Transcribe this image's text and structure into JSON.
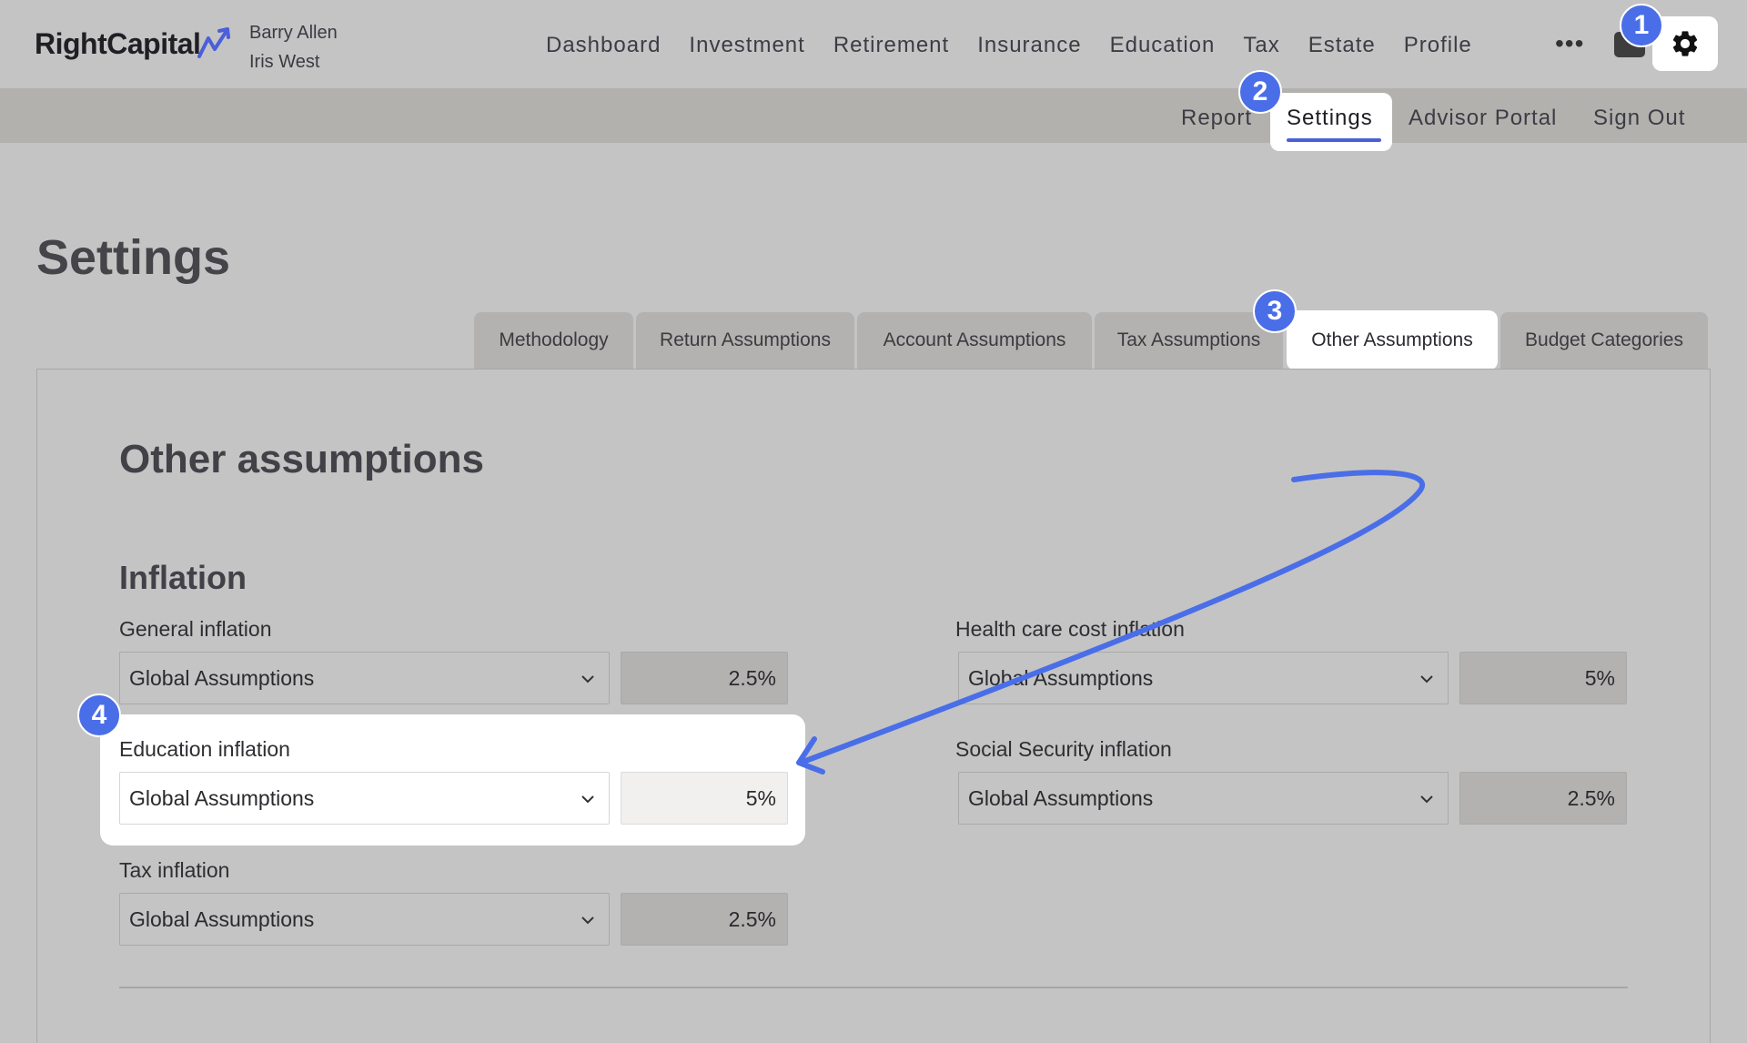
{
  "brand": {
    "name": "RightCapital"
  },
  "clients": [
    "Barry Allen",
    "Iris West"
  ],
  "main_nav": [
    "Dashboard",
    "Investment",
    "Retirement",
    "Insurance",
    "Education",
    "Tax",
    "Estate",
    "Profile"
  ],
  "more_label": "•••",
  "sub_nav": {
    "report": "Report",
    "settings": "Settings",
    "advisor_portal": "Advisor Portal",
    "sign_out": "Sign Out"
  },
  "page_title": "Settings",
  "tabs": [
    "Methodology",
    "Return Assumptions",
    "Account Assumptions",
    "Tax Assumptions",
    "Other Assumptions",
    "Budget Categories"
  ],
  "active_tab": "Other Assumptions",
  "section_title": "Other assumptions",
  "inflation": {
    "title": "Inflation",
    "general": {
      "label": "General inflation",
      "source": "Global Assumptions",
      "value": "2.5%"
    },
    "health": {
      "label": "Health care cost inflation",
      "source": "Global Assumptions",
      "value": "5%"
    },
    "education": {
      "label": "Education inflation",
      "source": "Global Assumptions",
      "value": "5%"
    },
    "social_security": {
      "label": "Social Security inflation",
      "source": "Global Assumptions",
      "value": "2.5%"
    },
    "tax": {
      "label": "Tax inflation",
      "source": "Global Assumptions",
      "value": "2.5%"
    }
  },
  "steps": [
    "1",
    "2",
    "3",
    "4"
  ],
  "colors": {
    "accent": "#4a6ee8",
    "overlay": "#c4c4c4",
    "highlight": "#ffffff"
  }
}
